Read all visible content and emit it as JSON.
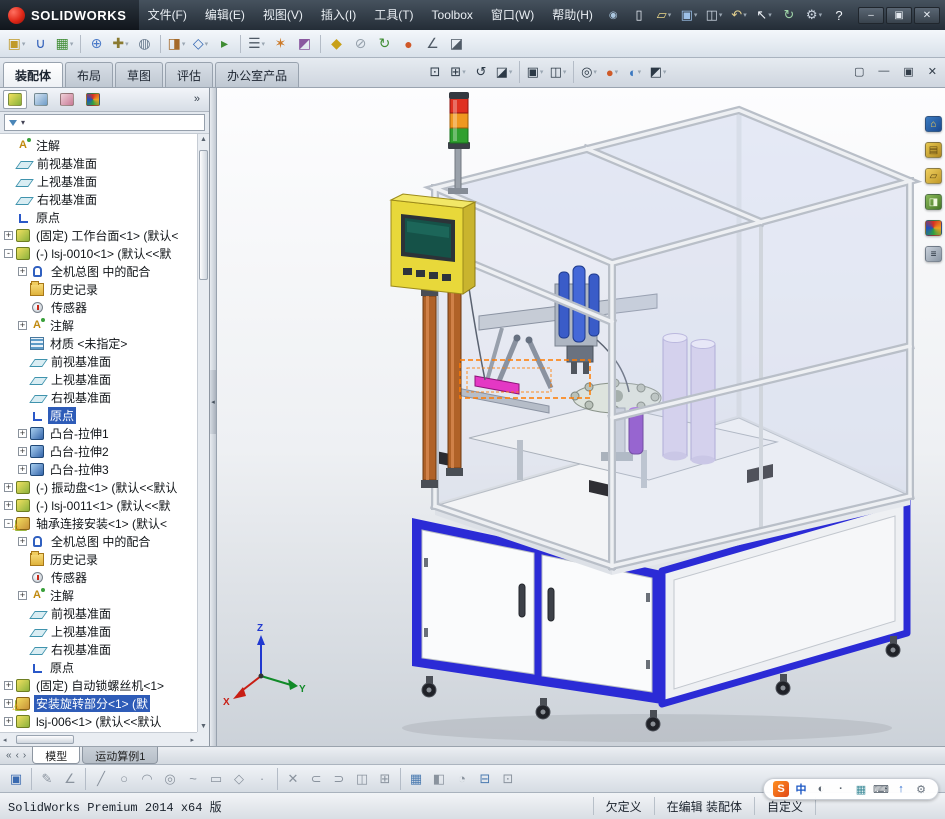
{
  "titlebar": {
    "logo_text": "SOLIDWORKS",
    "pin_glyph": "◉",
    "menus": [
      {
        "label": "文件(F)"
      },
      {
        "label": "编辑(E)"
      },
      {
        "label": "视图(V)"
      },
      {
        "label": "插入(I)"
      },
      {
        "label": "工具(T)"
      },
      {
        "label": "Toolbox"
      },
      {
        "label": "窗口(W)"
      },
      {
        "label": "帮助(H)"
      }
    ],
    "quick_icons": [
      {
        "name": "new-document-button",
        "glyph": "▯",
        "fg": "#e4eaf2"
      },
      {
        "name": "open-button",
        "glyph": "▱",
        "fg": "#ead788",
        "caret": true
      },
      {
        "name": "save-button",
        "glyph": "▣",
        "fg": "#9cc0e8",
        "caret": true
      },
      {
        "name": "print-button",
        "glyph": "◫",
        "fg": "#ccd5e0",
        "caret": true
      },
      {
        "name": "undo-button",
        "glyph": "↶",
        "fg": "#e2cf8e",
        "caret": true
      },
      {
        "name": "select-button",
        "glyph": "↖",
        "fg": "#eef2f7",
        "caret": true
      },
      {
        "name": "rebuild-button",
        "glyph": "↻",
        "fg": "#9fd4a8"
      },
      {
        "name": "options-button",
        "glyph": "⚙",
        "fg": "#ccd5e0",
        "caret": true
      },
      {
        "name": "help-button",
        "glyph": "?",
        "fg": "#eef2f7"
      }
    ],
    "window_buttons": [
      {
        "name": "app-minimize-button",
        "glyph": "–"
      },
      {
        "name": "app-restore-button",
        "glyph": "▣"
      },
      {
        "name": "app-close-button",
        "glyph": "✕"
      }
    ]
  },
  "assembly_toolbar": {
    "icons": [
      {
        "name": "insert-components-button",
        "glyph": "▣",
        "fg": "#c09a28",
        "caret": true
      },
      {
        "name": "mate-button",
        "glyph": "∪",
        "fg": "#2b5cb8"
      },
      {
        "name": "linear-component-pattern-button",
        "glyph": "▦",
        "fg": "#3e8c32",
        "caret": true
      },
      {
        "sep": true
      },
      {
        "name": "smart-fasteners-button",
        "glyph": "⊕",
        "fg": "#4a7ac8"
      },
      {
        "name": "move-component-button",
        "glyph": "✚",
        "fg": "#8a7a30",
        "caret": true
      },
      {
        "name": "show-hidden-components-button",
        "glyph": "◍",
        "fg": "#68798c"
      },
      {
        "sep": true
      },
      {
        "name": "assembly-features-button",
        "glyph": "◨",
        "fg": "#a56a2a",
        "caret": true
      },
      {
        "name": "reference-geometry-button",
        "glyph": "◇",
        "fg": "#3468b4",
        "caret": true
      },
      {
        "name": "new-motion-study-button",
        "glyph": "▸",
        "fg": "#3e8c32"
      },
      {
        "sep": true
      },
      {
        "name": "bill-of-materials-button",
        "glyph": "☰",
        "fg": "#4f5a66",
        "caret": true
      },
      {
        "name": "exploded-view-button",
        "glyph": "✶",
        "fg": "#cc7a28"
      },
      {
        "name": "interference-detection-button",
        "glyph": "◩",
        "fg": "#8a58a0"
      },
      {
        "sep": true
      },
      {
        "name": "instant-3d-button",
        "glyph": "◆",
        "fg": "#c8a018"
      },
      {
        "name": "external-references-button",
        "glyph": "⊘",
        "fg": "#95a0ab"
      },
      {
        "name": "rebuild-assembly-button",
        "glyph": "↻",
        "fg": "#3e8c32"
      },
      {
        "name": "appearance-button",
        "glyph": "●",
        "fg": "#d05828"
      },
      {
        "name": "measure-button",
        "glyph": "∠",
        "fg": "#4f5a66"
      },
      {
        "name": "section-tool-button",
        "glyph": "◪",
        "fg": "#4f5a66"
      }
    ]
  },
  "command_bar": {
    "tabs": [
      {
        "label": "装配体",
        "active": true
      },
      {
        "label": "布局"
      },
      {
        "label": "草图"
      },
      {
        "label": "评估"
      },
      {
        "label": "办公室产品"
      }
    ],
    "view_icons": [
      {
        "name": "zoom-to-fit-button",
        "glyph": "⊡",
        "fg": "#2c3946"
      },
      {
        "name": "zoom-to-area-button",
        "glyph": "⊞",
        "fg": "#2c3946",
        "caret": true
      },
      {
        "name": "previous-view-button",
        "glyph": "↺",
        "fg": "#2c3946"
      },
      {
        "name": "section-view-button",
        "glyph": "◪",
        "fg": "#2c3946",
        "caret": true
      },
      {
        "sep": true
      },
      {
        "name": "view-orientation-button",
        "glyph": "▣",
        "fg": "#2c3946",
        "caret": true
      },
      {
        "name": "display-style-button",
        "glyph": "◫",
        "fg": "#2c3946",
        "caret": true
      },
      {
        "sep": true
      },
      {
        "name": "hide-show-items-button",
        "glyph": "◎",
        "fg": "#2c3946",
        "caret": true
      },
      {
        "name": "edit-appearance-button",
        "glyph": "●",
        "fg": "#cf5a28",
        "caret": true
      },
      {
        "name": "apply-scene-button",
        "glyph": "◐",
        "fg": "#3a78c0",
        "caret": true
      },
      {
        "name": "view-settings-button",
        "glyph": "◩",
        "fg": "#2c3946",
        "caret": true
      }
    ],
    "doc_buttons": [
      {
        "name": "doc-new-window-button",
        "glyph": "▢"
      },
      {
        "name": "doc-minimize-button",
        "glyph": "—"
      },
      {
        "name": "doc-restore-button",
        "glyph": "▣"
      },
      {
        "name": "doc-close-button",
        "glyph": "✕"
      }
    ]
  },
  "feature_panel": {
    "tabs": [
      {
        "name": "featuremanager-tab",
        "bg": "linear-gradient(135deg,#f2e05e,#86b23a)",
        "active": true
      },
      {
        "name": "propertymanager-tab",
        "bg": "linear-gradient(135deg,#d5e4f2,#6f9cc8)"
      },
      {
        "name": "configurationmanager-tab",
        "bg": "linear-gradient(135deg,#f0d0d8,#c87a96)"
      },
      {
        "name": "displaymanager-tab",
        "bg": "conic-gradient(#d83020,#f0a020,#2fa040,#2050c0,#d83020)"
      }
    ],
    "overflow_glyph": "»",
    "filter_caret": "▾",
    "collapse_glyph": "◂",
    "scroll_up": "▲",
    "scroll_down": "▼",
    "scroll_left": "◂",
    "scroll_right": "▸",
    "items": [
      {
        "icon": "ic-ann",
        "label": "注解",
        "level": 0
      },
      {
        "icon": "ic-plane",
        "label": "前视基准面",
        "level": 0
      },
      {
        "icon": "ic-plane",
        "label": "上视基准面",
        "level": 0
      },
      {
        "icon": "ic-plane",
        "label": "右视基准面",
        "level": 0
      },
      {
        "icon": "ic-origin",
        "label": "原点",
        "level": 0
      },
      {
        "exp": "+",
        "icon": "ic-part",
        "label": "(固定) 工作台面<1> (默认<",
        "level": 0
      },
      {
        "exp": "-",
        "icon": "ic-part",
        "label": "(-) lsj-0010<1> (默认<<默",
        "level": 0
      },
      {
        "exp": "+",
        "icon": "ic-mate",
        "label": "全机总图 中的配合",
        "level": 1
      },
      {
        "icon": "ic-hist",
        "label": "历史记录",
        "level": 1
      },
      {
        "icon": "ic-sensor",
        "label": "传感器",
        "level": 1
      },
      {
        "exp": "+",
        "icon": "ic-ann",
        "label": "注解",
        "level": 1
      },
      {
        "icon": "ic-mat",
        "label": "材质 <未指定>",
        "level": 1
      },
      {
        "icon": "ic-plane",
        "label": "前视基准面",
        "level": 1
      },
      {
        "icon": "ic-plane",
        "label": "上视基准面",
        "level": 1
      },
      {
        "icon": "ic-plane",
        "label": "右视基准面",
        "level": 1
      },
      {
        "icon": "ic-origin",
        "label": "原点",
        "level": 1,
        "sel": true
      },
      {
        "exp": "+",
        "icon": "ic-extrude",
        "label": "凸台-拉伸1",
        "level": 1
      },
      {
        "exp": "+",
        "icon": "ic-extrude",
        "label": "凸台-拉伸2",
        "level": 1
      },
      {
        "exp": "+",
        "icon": "ic-extrude",
        "label": "凸台-拉伸3",
        "level": 1
      },
      {
        "exp": "+",
        "icon": "ic-part",
        "label": "(-) 振动盘<1> (默认<<默认",
        "level": 0
      },
      {
        "exp": "+",
        "icon": "ic-part",
        "label": "(-) lsj-0011<1> (默认<<默",
        "level": 0
      },
      {
        "exp": "-",
        "icon": "ic-asm",
        "warn": "⚠",
        "label": "轴承连接安装<1> (默认<",
        "level": 0
      },
      {
        "exp": "+",
        "icon": "ic-mate",
        "label": "全机总图 中的配合",
        "level": 1
      },
      {
        "icon": "ic-hist",
        "label": "历史记录",
        "level": 1
      },
      {
        "icon": "ic-sensor",
        "label": "传感器",
        "level": 1
      },
      {
        "exp": "+",
        "icon": "ic-ann",
        "label": "注解",
        "level": 1
      },
      {
        "icon": "ic-plane",
        "label": "前视基准面",
        "level": 1
      },
      {
        "icon": "ic-plane",
        "label": "上视基准面",
        "level": 1
      },
      {
        "icon": "ic-plane",
        "label": "右视基准面",
        "level": 1
      },
      {
        "icon": "ic-origin",
        "label": "原点",
        "level": 1
      },
      {
        "exp": "+",
        "icon": "ic-part",
        "label": "(固定) 自动锁螺丝机<1>",
        "level": 0
      },
      {
        "exp": "+",
        "icon": "ic-asm",
        "warn": "⚠",
        "label": "安装旋转部分<1> (默",
        "level": 0,
        "sel": true
      },
      {
        "exp": "+",
        "icon": "ic-part",
        "label": "lsj-006<1> (默认<<默认",
        "level": 0
      }
    ]
  },
  "viewport": {
    "triad": {
      "x": "X",
      "y": "Y",
      "z": "Z"
    },
    "colors": {
      "cabinet_blue": "#2b2bd6",
      "hmi_yellow": "#e8d83a",
      "light_red": "#e03020",
      "light_amber": "#f09820",
      "light_green": "#30a030",
      "highlight_pink": "#e438c4",
      "selection_orange": "#ff7a00",
      "tank_purple": "#d6d0ee",
      "rail_copper": "#b06228"
    }
  },
  "task_pane": {
    "icons": [
      {
        "name": "solidworks-resources-tab",
        "glyph": "⌂",
        "fg": "#ffd24a",
        "bg": "linear-gradient(135deg,#3a7ac0,#1a4a90)"
      },
      {
        "name": "design-library-tab",
        "glyph": "▤",
        "fg": "#604810",
        "bg": "linear-gradient(135deg,#e8c850,#b08820)"
      },
      {
        "name": "file-explorer-tab",
        "glyph": "▱",
        "fg": "#5a4410",
        "bg": "linear-gradient(135deg,#f0d060,#c09828)"
      },
      {
        "name": "view-palette-tab",
        "glyph": "◨",
        "fg": "#f0f8e0",
        "bg": "linear-gradient(135deg,#88b858,#487828)"
      },
      {
        "name": "appearances-tab",
        "glyph": "",
        "fg": "#fff",
        "bg": "conic-gradient(#d83020,#f0a020,#2fa040,#2050c0,#d83020)"
      },
      {
        "name": "custom-properties-tab",
        "glyph": "≡",
        "fg": "#222c38",
        "bg": "linear-gradient(135deg,#c8d0da,#8a96a4)"
      }
    ]
  },
  "model_tabs": {
    "nav": [
      {
        "name": "tab-scroll-start-button",
        "glyph": "«"
      },
      {
        "name": "tab-scroll-left-button",
        "glyph": "‹"
      },
      {
        "name": "tab-scroll-right-button",
        "glyph": "›"
      }
    ],
    "tabs": [
      {
        "label": "模型",
        "active": true
      },
      {
        "label": "运动算例1"
      }
    ]
  },
  "bottom_toolbar": {
    "icons": [
      {
        "name": "save-button",
        "glyph": "▣",
        "fg": "#3a6ab0"
      },
      {
        "sep": true
      },
      {
        "name": "sketch-button",
        "glyph": "✎"
      },
      {
        "name": "smart-dimension-button",
        "glyph": "∠"
      },
      {
        "sep": true
      },
      {
        "name": "line-tool-button",
        "glyph": "╱"
      },
      {
        "name": "circle-tool-button",
        "glyph": "○"
      },
      {
        "name": "arc-tool-button",
        "glyph": "◠"
      },
      {
        "name": "ellipse-tool-button",
        "glyph": "◎"
      },
      {
        "name": "spline-tool-button",
        "glyph": "~"
      },
      {
        "name": "rectangle-tool-button",
        "glyph": "▭"
      },
      {
        "name": "polygon-tool-button",
        "glyph": "◇"
      },
      {
        "name": "point-tool-button",
        "glyph": "·"
      },
      {
        "sep": true
      },
      {
        "name": "trim-entities-button",
        "glyph": "✕"
      },
      {
        "name": "convert-entities-button",
        "glyph": "⊂"
      },
      {
        "name": "offset-entities-button",
        "glyph": "⊃"
      },
      {
        "name": "mirror-entities-button",
        "glyph": "◫"
      },
      {
        "name": "linear-sketch-pattern-button",
        "glyph": "⊞"
      },
      {
        "sep": true
      },
      {
        "name": "grid-system-button",
        "glyph": "▦",
        "fg": "#4a7ab0"
      },
      {
        "name": "extruded-boss-button",
        "glyph": "◧"
      },
      {
        "name": "revolved-boss-button",
        "glyph": "◔"
      },
      {
        "name": "snap-grid-button",
        "glyph": "⊟",
        "fg": "#4a7ab0"
      },
      {
        "name": "units-button",
        "glyph": "⊡"
      }
    ]
  },
  "statusbar": {
    "left": "SolidWorks Premium 2014 x64 版",
    "constraint_status": "欠定义",
    "edit_status": "在编辑 装配体",
    "customize": "自定义",
    "ime": [
      {
        "name": "sogou-logo-icon",
        "glyph": "S",
        "fg": "#ffffff",
        "bg": "linear-gradient(135deg,#ff9020,#e04818)"
      },
      {
        "name": "ime-language-button",
        "glyph": "中",
        "fg": "#1a56c4"
      },
      {
        "name": "ime-fullhalf-button",
        "glyph": "◐",
        "fg": "#5a6470"
      },
      {
        "name": "ime-punctuation-button",
        "glyph": "·",
        "fg": "#5a6470"
      },
      {
        "name": "ime-skin-button",
        "glyph": "▦",
        "fg": "#3a8a98"
      },
      {
        "name": "ime-keyboard-button",
        "glyph": "⌨",
        "fg": "#44505c"
      },
      {
        "name": "ime-up-button",
        "glyph": "↑",
        "fg": "#2a6ad0"
      },
      {
        "name": "ime-tool-button",
        "glyph": "⚙",
        "fg": "#6a7480"
      }
    ]
  }
}
